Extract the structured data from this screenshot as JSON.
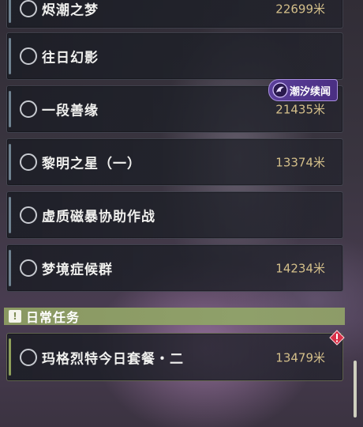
{
  "quests": [
    {
      "name": "烬潮之梦",
      "distance": "22699米"
    },
    {
      "name": "往日幻影",
      "distance": ""
    },
    {
      "name": "一段善缘",
      "distance": "21435米"
    },
    {
      "name": "黎明之星（一）",
      "distance": "13374米"
    },
    {
      "name": "虚质磁暴协助作战",
      "distance": ""
    },
    {
      "name": "梦境症候群",
      "distance": "14234米"
    }
  ],
  "badge": {
    "label": "潮汐续闻",
    "icon": "tidal-swirl-icon",
    "color": "#5b3f9a"
  },
  "daily": {
    "section_title": "日常任务",
    "section_icon": "exclamation-icon",
    "quest": {
      "name": "玛格烈特今日套餐・二",
      "distance": "13479米"
    },
    "alert_icon": "red-diamond-alert-icon"
  },
  "colors": {
    "distance_text": "#d4bf8a",
    "daily_header": "#8fa06a",
    "alert": "#d83048"
  }
}
